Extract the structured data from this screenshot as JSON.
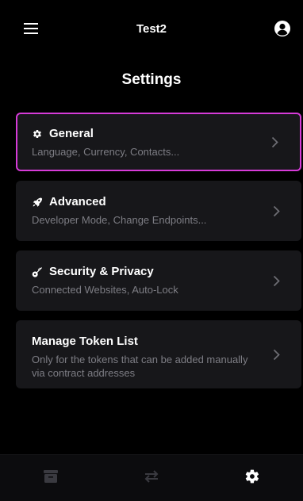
{
  "header": {
    "app_title": "Test2"
  },
  "page": {
    "title": "Settings"
  },
  "settings": [
    {
      "id": "general",
      "title": "General",
      "description": "Language, Currency, Contacts...",
      "icon": "gear-icon",
      "selected": true
    },
    {
      "id": "advanced",
      "title": "Advanced",
      "description": "Developer Mode, Change Endpoints...",
      "icon": "rocket-icon",
      "selected": false
    },
    {
      "id": "security",
      "title": "Security & Privacy",
      "description": "Connected Websites, Auto-Lock",
      "icon": "key-icon",
      "selected": false
    },
    {
      "id": "tokens",
      "title": "Manage Token List",
      "description": "Only for the tokens that can be added manually via contract addresses",
      "icon": "",
      "selected": false
    }
  ],
  "bottom_nav": [
    {
      "id": "wallet",
      "icon": "wallet-icon",
      "active": false
    },
    {
      "id": "swap",
      "icon": "swap-arrows-icon",
      "active": false
    },
    {
      "id": "settings",
      "icon": "gear-icon",
      "active": true
    }
  ],
  "colors": {
    "background": "#000000",
    "card": "#17171a",
    "accent": "#d63bd8",
    "muted_text": "#7d7d84",
    "inactive_icon": "#3a3a40"
  }
}
